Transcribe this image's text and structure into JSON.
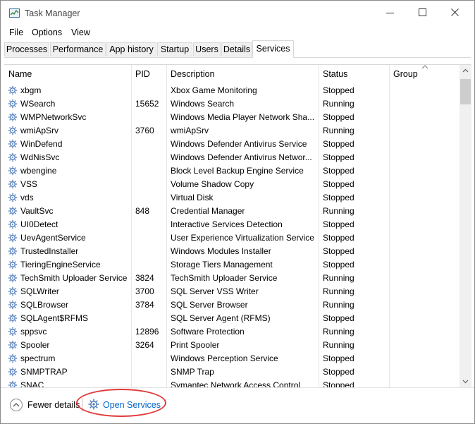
{
  "window": {
    "title": "Task Manager"
  },
  "menu": [
    "File",
    "Options",
    "View"
  ],
  "tabs": [
    "Processes",
    "Performance",
    "App history",
    "Startup",
    "Users",
    "Details",
    "Services"
  ],
  "active_tab": "Services",
  "table": {
    "headers": [
      "Name",
      "PID",
      "Description",
      "Status",
      "Group"
    ],
    "sorted_column": "Group",
    "rows": [
      {
        "name": "xbgm",
        "pid": "",
        "description": "Xbox Game Monitoring",
        "status": "Stopped"
      },
      {
        "name": "WSearch",
        "pid": "15652",
        "description": "Windows Search",
        "status": "Running"
      },
      {
        "name": "WMPNetworkSvc",
        "pid": "",
        "description": "Windows Media Player Network Sha...",
        "status": "Stopped"
      },
      {
        "name": "wmiApSrv",
        "pid": "3760",
        "description": "wmiApSrv",
        "status": "Running"
      },
      {
        "name": "WinDefend",
        "pid": "",
        "description": "Windows Defender Antivirus Service",
        "status": "Stopped"
      },
      {
        "name": "WdNisSvc",
        "pid": "",
        "description": "Windows Defender Antivirus Networ...",
        "status": "Stopped"
      },
      {
        "name": "wbengine",
        "pid": "",
        "description": "Block Level Backup Engine Service",
        "status": "Stopped"
      },
      {
        "name": "VSS",
        "pid": "",
        "description": "Volume Shadow Copy",
        "status": "Stopped"
      },
      {
        "name": "vds",
        "pid": "",
        "description": "Virtual Disk",
        "status": "Stopped"
      },
      {
        "name": "VaultSvc",
        "pid": "848",
        "description": "Credential Manager",
        "status": "Running"
      },
      {
        "name": "UI0Detect",
        "pid": "",
        "description": "Interactive Services Detection",
        "status": "Stopped"
      },
      {
        "name": "UevAgentService",
        "pid": "",
        "description": "User Experience Virtualization Service",
        "status": "Stopped"
      },
      {
        "name": "TrustedInstaller",
        "pid": "",
        "description": "Windows Modules Installer",
        "status": "Stopped"
      },
      {
        "name": "TieringEngineService",
        "pid": "",
        "description": "Storage Tiers Management",
        "status": "Stopped"
      },
      {
        "name": "TechSmith Uploader Service",
        "pid": "3824",
        "description": "TechSmith Uploader Service",
        "status": "Running"
      },
      {
        "name": "SQLWriter",
        "pid": "3700",
        "description": "SQL Server VSS Writer",
        "status": "Running"
      },
      {
        "name": "SQLBrowser",
        "pid": "3784",
        "description": "SQL Server Browser",
        "status": "Running"
      },
      {
        "name": "SQLAgent$RFMS",
        "pid": "",
        "description": "SQL Server Agent (RFMS)",
        "status": "Stopped"
      },
      {
        "name": "sppsvc",
        "pid": "12896",
        "description": "Software Protection",
        "status": "Running"
      },
      {
        "name": "Spooler",
        "pid": "3264",
        "description": "Print Spooler",
        "status": "Running"
      },
      {
        "name": "spectrum",
        "pid": "",
        "description": "Windows Perception Service",
        "status": "Stopped"
      },
      {
        "name": "SNMPTRAP",
        "pid": "",
        "description": "SNMP Trap",
        "status": "Stopped"
      },
      {
        "name": "SNAC",
        "pid": "",
        "description": "Symantec Network Access Control",
        "status": "Stopped"
      }
    ]
  },
  "footer": {
    "fewer_details": "Fewer details",
    "open_services": "Open Services"
  },
  "colors": {
    "link": "#0066cc",
    "highlight": "#e03a3a",
    "gear": "#4a78b8"
  }
}
